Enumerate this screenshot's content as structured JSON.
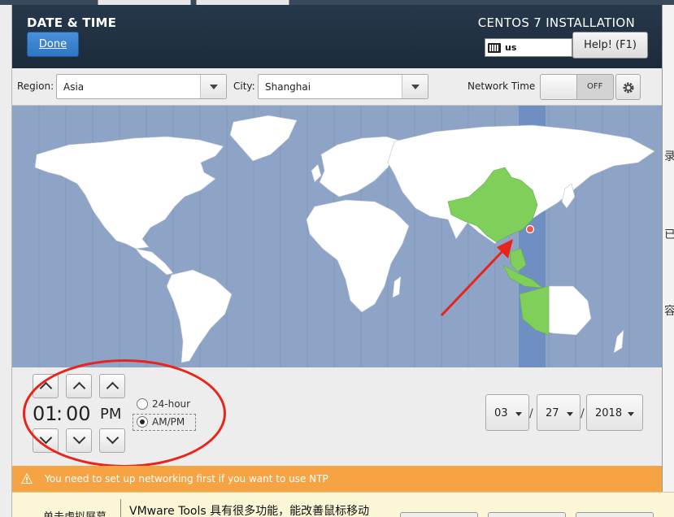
{
  "header": {
    "title": "DATE & TIME",
    "done_label": "Done",
    "product_title": "CENTOS 7 INSTALLATION",
    "keyboard_layout": "us",
    "help_label": "Help! (F1)"
  },
  "toolbar": {
    "region_label": "Region:",
    "region_value": "Asia",
    "city_label": "City:",
    "city_value": "Shanghai",
    "network_time_label": "Network Time",
    "network_time_state": "OFF"
  },
  "map": {
    "selected_timezone": "Asia/Shanghai",
    "marker_city": "Shanghai",
    "colors": {
      "ocean": "#8ea4c6",
      "land": "#ffffff",
      "selected": "#7fcf5a",
      "band": "#6f8fc3",
      "arrow": "#e8241c"
    }
  },
  "time": {
    "hours": "01",
    "separator": ":",
    "minutes": "00",
    "period": "PM",
    "format_24h_label": "24-hour",
    "format_ampm_label": "AM/PM",
    "selected_format": "AM/PM"
  },
  "date": {
    "month": "03",
    "day": "27",
    "year": "2018",
    "separator": "/"
  },
  "warning": {
    "text": "You need to set up networking first if you want to use NTP"
  },
  "vmware_bar": {
    "left_text": "单击虚拟屏幕",
    "message": "VMware Tools 具有很多功能，能改善鼠标移动"
  },
  "background_window": {
    "chars": [
      "录",
      "已",
      "容"
    ]
  }
}
